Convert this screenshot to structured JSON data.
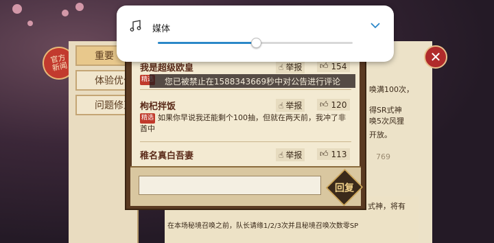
{
  "volume_panel": {
    "icon": "music-note-icon",
    "label": "媒体",
    "level": 0.5,
    "accent": "#2a87c8"
  },
  "left_tabs": [
    {
      "label": "重要",
      "active": true
    },
    {
      "label": "体验优化",
      "active": false
    },
    {
      "label": "问题修正",
      "active": false
    }
  ],
  "official_badge": {
    "line1": "官方",
    "line2": "新闻"
  },
  "toast": "您已被禁止在1588343669秒中对公告进行评论",
  "comments": [
    {
      "name": "我是超级欧皇",
      "report": "举报",
      "likes": "154",
      "tag": "精选",
      "body": ""
    },
    {
      "name": "枸杞拌饭",
      "report": "举报",
      "likes": "120",
      "tag": "精选",
      "body": "如果你早说我还能剩个100抽，但就在两天前，我冲了非酋中"
    },
    {
      "name": "稚名真白吾妻",
      "report": "举报",
      "likes": "113",
      "tag": "",
      "body": ""
    }
  ],
  "reply": {
    "button_label": "回复",
    "placeholder": ""
  },
  "right_snippets": [
    "唤满100次，",
    "得SR式神",
    "唤5次风狸",
    "开放。",
    "769"
  ],
  "bottom_snippets": [
    "式神，将有",
    "在本场秘境召唤之前，队长请缘1/2/3次并且秘境召唤次数零SP"
  ]
}
